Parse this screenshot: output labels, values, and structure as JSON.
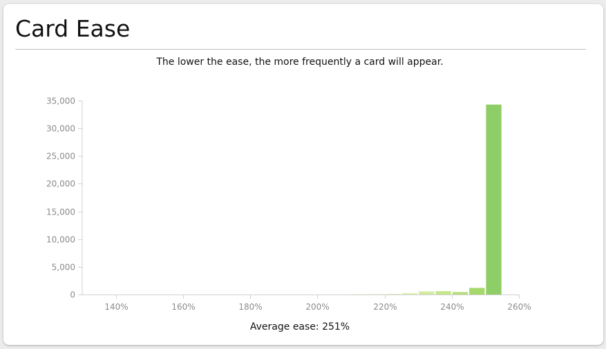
{
  "header": {
    "title": "Card Ease"
  },
  "chart_data": {
    "type": "bar",
    "subtitle": "The lower the ease, the more frequently a card will appear.",
    "x_tick_labels": [
      "140%",
      "160%",
      "180%",
      "200%",
      "220%",
      "240%",
      "260%"
    ],
    "y_tick_labels": [
      "0",
      "5,000",
      "10,000",
      "15,000",
      "20,000",
      "25,000",
      "30,000",
      "35,000"
    ],
    "xlim": [
      130,
      260
    ],
    "ylim": [
      0,
      35000
    ],
    "bin_width": 5,
    "x_bin_starts": [
      210,
      215,
      220,
      225,
      230,
      235,
      240,
      245,
      250
    ],
    "values": [
      60,
      80,
      120,
      250,
      550,
      600,
      450,
      1200,
      34300
    ],
    "colors": [
      "#f4f9e3",
      "#eef6d4",
      "#e6f3c4",
      "#ddefb4",
      "#d2eb9f",
      "#c6e68a",
      "#b7e07a",
      "#a6d96c",
      "#8fce66"
    ],
    "grid": false,
    "legend": "none",
    "average_label": "Average ease: 251%"
  }
}
